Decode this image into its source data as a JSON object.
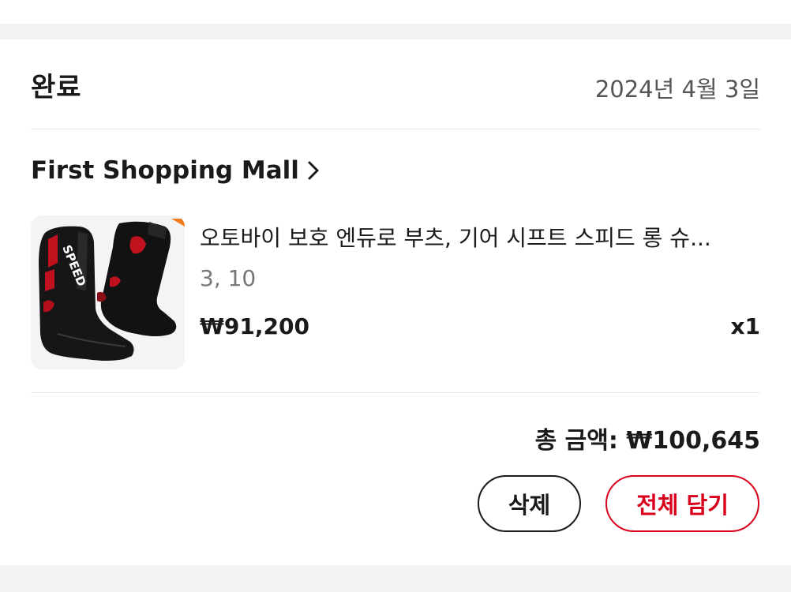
{
  "order": {
    "status": "완료",
    "date": "2024년 4월 3일"
  },
  "store": {
    "name": "First Shopping Mall",
    "chevron_icon": "chevron-right-icon"
  },
  "product": {
    "name": "오토바이 보호 엔듀로 부츠, 기어 시프트 스피드 롱 슈...",
    "option": "3, 10",
    "price": "₩91,200",
    "quantity": "x1",
    "image_brand_text": "SPEED"
  },
  "total": {
    "label": "총 금액: ₩100,645"
  },
  "actions": {
    "delete_label": "삭제",
    "add_all_label": "전체 담기"
  },
  "colors": {
    "accent": "#d9001b",
    "text": "#1a1a1a",
    "muted": "#777777",
    "background": "#f2f2f2"
  }
}
